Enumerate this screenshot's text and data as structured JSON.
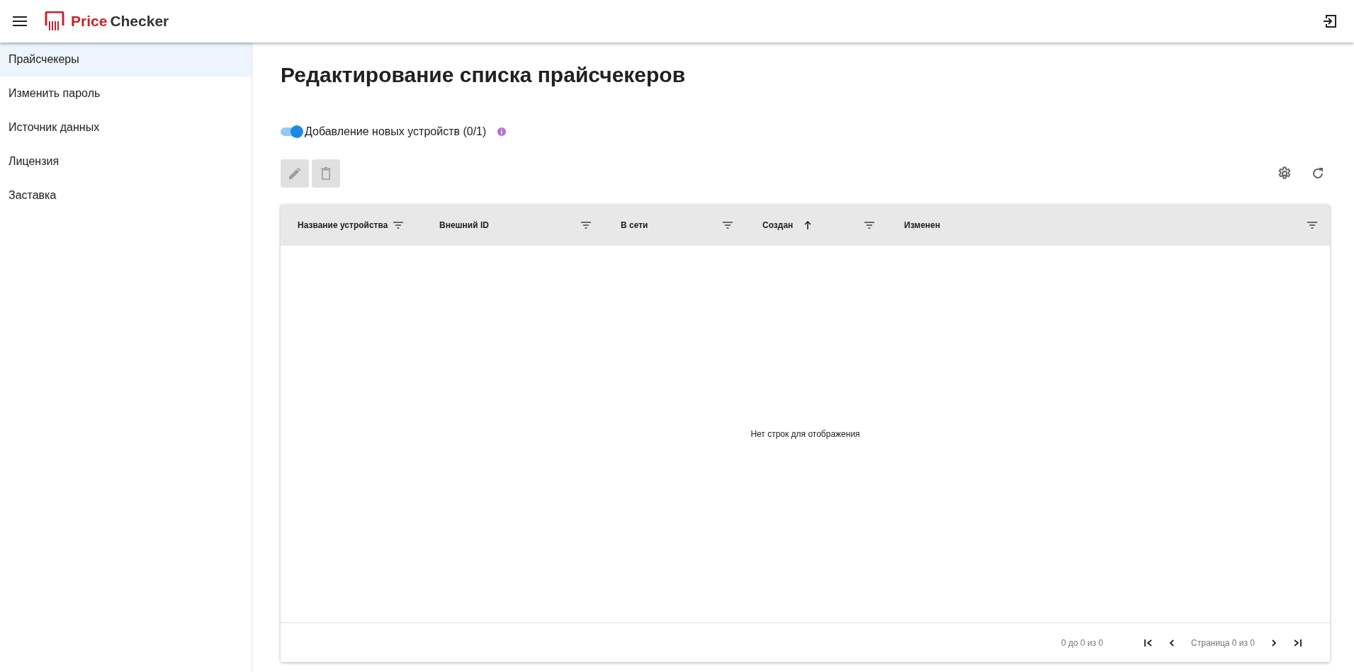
{
  "app_bar": {
    "logo_text_1": "Price",
    "logo_text_2": "Checker"
  },
  "sidebar": {
    "items": [
      {
        "label": "Прайсчекеры",
        "selected": true
      },
      {
        "label": "Изменить пароль",
        "selected": false
      },
      {
        "label": "Источник данных",
        "selected": false
      },
      {
        "label": "Лицензия",
        "selected": false
      },
      {
        "label": "Заставка",
        "selected": false
      }
    ]
  },
  "page_title": "Редактирование списка прайсчекеров",
  "toggle": {
    "label": "Добавление новых устройств (0/1)",
    "on": true
  },
  "toolbar": {
    "edit_disabled": true,
    "delete_disabled": true
  },
  "table": {
    "columns": [
      {
        "label": "Название устройства",
        "sorted": false
      },
      {
        "label": "Внешний ID",
        "sorted": false
      },
      {
        "label": "В сети",
        "sorted": false
      },
      {
        "label": "Создан",
        "sorted": true
      },
      {
        "label": "Изменен",
        "sorted": false
      }
    ],
    "empty_text": "Нет строк для отображения",
    "range_text": "0 до 0 из 0",
    "page_text": "Страница 0 из 0"
  }
}
